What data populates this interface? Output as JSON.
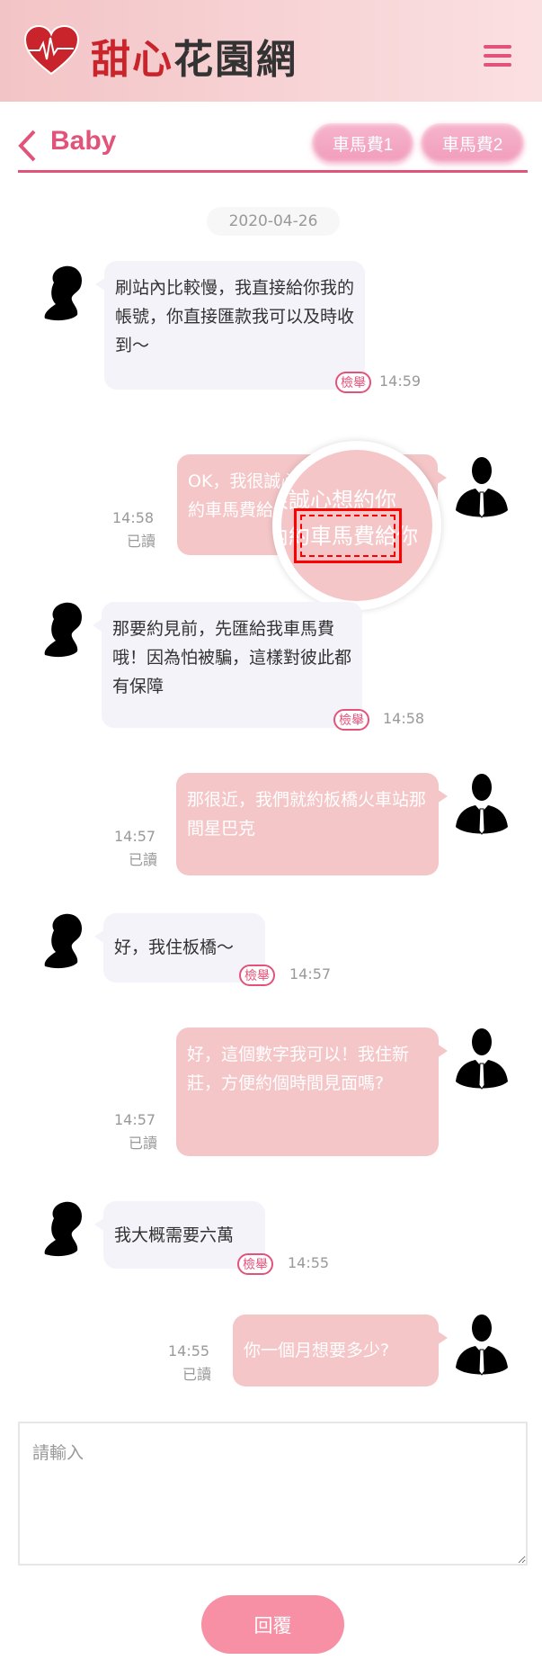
{
  "header": {
    "logo_text_red": "甜心",
    "logo_text_dark": "花園網"
  },
  "chat": {
    "title": "Baby",
    "buttons": [
      "車馬費1",
      "車馬費2"
    ],
    "date": "2020-04-26"
  },
  "messages": [
    {
      "from": "her",
      "text": "刷站內比較慢，我直接給你我的帳號，你直接匯款我可以及時收到～",
      "time": "14:59",
      "report": "檢舉"
    },
    {
      "from": "me",
      "text": "OK，我很誠心想約你 刷網站內約車馬費給你",
      "time": "14:58",
      "status": "已讀"
    },
    {
      "from": "her",
      "text": "那要約見前，先匯給我車馬費哦！因為怕被騙，這樣對彼此都有保障",
      "time": "14:58",
      "report": "檢舉"
    },
    {
      "from": "me",
      "text": "那很近，我們就約板橋火車站那間星巴克",
      "time": "14:57",
      "status": "已讀"
    },
    {
      "from": "her",
      "text": "好，我住板橋～",
      "time": "14:57",
      "report": "檢舉"
    },
    {
      "from": "me",
      "text": "好，這個數字我可以！我住新莊，方便約個時間見面嗎?",
      "time": "14:57",
      "status": "已讀"
    },
    {
      "from": "her",
      "text": "我大概需要六萬",
      "time": "14:55",
      "report": "檢舉"
    },
    {
      "from": "me",
      "text": "你一個月想要多少?",
      "time": "14:55",
      "status": "已讀"
    }
  ],
  "magnifier": {
    "line1": "很誠心想約你",
    "line2": "內約車馬費給你"
  },
  "composer": {
    "placeholder": "請輸入",
    "reply_label": "回覆"
  },
  "colors": {
    "accent": "#e2537a",
    "me_bubble": "#f5c6c8",
    "her_bubble": "#f4f3f9",
    "reply": "#f78fa5"
  }
}
